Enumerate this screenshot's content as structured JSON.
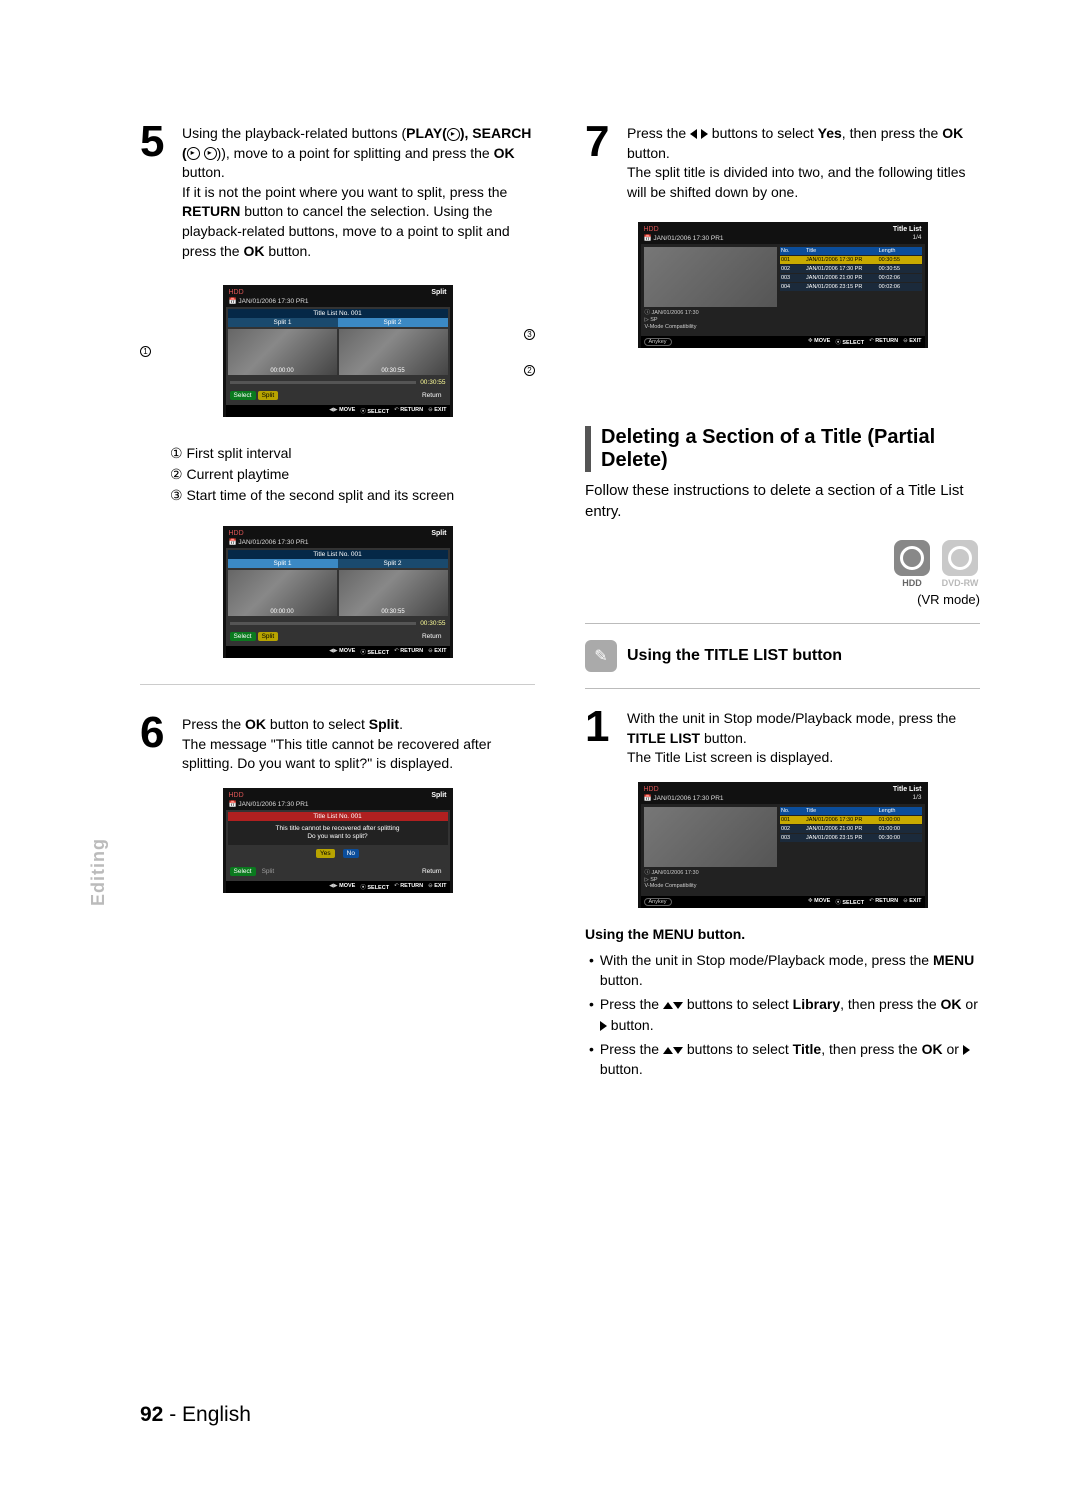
{
  "page_number": "92",
  "page_lang": "English",
  "side_tab": "Editing",
  "left": {
    "step5": {
      "text1": "Using the playback-related buttons (",
      "play": "PLAY(",
      "play2": "),",
      "search": "SEARCH (",
      "search2": ")), move to a point for splitting and press the ",
      "ok": "OK",
      "text2": " button.",
      "text3": "If it is not the point where you want to split, press the ",
      "return": "RETURN",
      "text4": " button to cancel the selection. Using the playback-related buttons, move to a point to split and press the ",
      "text5": " button."
    },
    "notes": {
      "n1": "First split interval",
      "n2": "Current playtime",
      "n3": "Start time of the second split and its screen"
    },
    "step6": {
      "t1": "Press the ",
      "ok": "OK",
      "t2": " button to select ",
      "split": "Split",
      "t3": ".",
      "t4": "The message \"This title cannot be recovered after splitting. Do you want to split?\" is displayed."
    },
    "shot_common": {
      "drive": "HDD",
      "mode": "Split",
      "sub": "JAN/01/2006 17:30 PR1",
      "titlebar": "Title List No. 001",
      "split1": "Split 1",
      "split2": "Split 2",
      "t_left": "00:00:00",
      "t_right": "00:30:55",
      "playtime": "00:30:55",
      "btn_select": "Select",
      "btn_split": "Split",
      "btn_return": "Return",
      "help_move": "MOVE",
      "help_select": "SELECT",
      "help_return": "RETURN",
      "help_exit": "EXIT",
      "dlg1": "This title cannot be recovered after splitting",
      "dlg2": "Do you want to split?",
      "yes": "Yes",
      "no": "No"
    }
  },
  "right": {
    "step7": {
      "t1": "Press the ",
      "t2": " buttons to select ",
      "yes": "Yes",
      "t3": ", then press the ",
      "ok": "OK",
      "t4": " button.",
      "t5": "The split title is divided into two, and the following titles will be shifted down by one."
    },
    "section": {
      "title": "Deleting a Section of a Title (Partial Delete)",
      "intro": "Follow these instructions to delete a section of a Title List entry.",
      "badge_hdd": "HDD",
      "badge_dvd": "DVD-RW",
      "vr": "(VR mode)",
      "sub": "Using the TITLE LIST button"
    },
    "step1": {
      "t1": "With the unit in Stop mode/Playback mode, press the ",
      "tl": "TITLE LIST",
      "t2": " button.",
      "t3": "The Title List screen is displayed."
    },
    "menu": {
      "head": "Using the MENU button.",
      "b1a": "With the unit in Stop mode/Playback mode, press the ",
      "b1b": "MENU",
      "b1c": " button.",
      "b2a": "Press the ",
      "b2b": " buttons to select ",
      "b2c": "Library",
      "b2d": ", then press the ",
      "b2e": "OK",
      "b2f": " or ",
      "b2g": " button.",
      "b3a": "Press the ",
      "b3b": " buttons to select ",
      "b3c": "Title",
      "b3d": ", then press the ",
      "b3e": "OK",
      "b3f": " or ",
      "b3g": " button."
    },
    "tlist": {
      "drive": "HDD",
      "label": "Title List",
      "sub": "JAN/01/2006 17:30 PR1",
      "cols": {
        "no": "No.",
        "title": "Title",
        "len": "Length"
      },
      "meta1": "JAN/01/2006 17:30",
      "meta2": "SP",
      "meta3": "V-Mode Compatibility",
      "anykey": "Anykey",
      "shot7": {
        "pages": "1/4",
        "rows": [
          {
            "no": "001",
            "title": "JAN/01/2006 17:30 PR",
            "len": "00:30:55"
          },
          {
            "no": "002",
            "title": "JAN/01/2006 17:30 PR",
            "len": "00:30:55"
          },
          {
            "no": "003",
            "title": "JAN/01/2006 21:00 PR",
            "len": "00:02:06"
          },
          {
            "no": "004",
            "title": "JAN/01/2006 23:15 PR",
            "len": "00:02:06"
          }
        ]
      },
      "shot1": {
        "pages": "1/3",
        "rows": [
          {
            "no": "001",
            "title": "JAN/01/2006 17:30 PR",
            "len": "01:00:00"
          },
          {
            "no": "002",
            "title": "JAN/01/2006 21:00 PR",
            "len": "01:00:00"
          },
          {
            "no": "003",
            "title": "JAN/01/2006 23:15 PR",
            "len": "00:30:00"
          }
        ]
      },
      "help_move": "MOVE",
      "help_select": "SELECT",
      "help_return": "RETURN",
      "help_exit": "EXIT"
    }
  }
}
